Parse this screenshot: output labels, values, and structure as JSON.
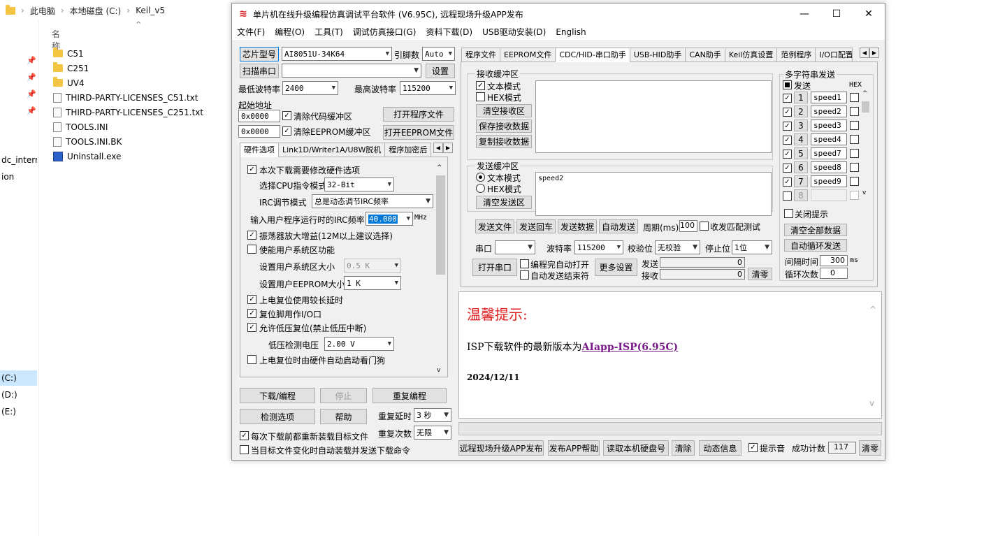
{
  "explorer": {
    "breadcrumb": [
      "此电脑",
      "本地磁盘 (C:)",
      "Keil_v5"
    ],
    "column_name": "名称",
    "files": [
      {
        "name": "C51",
        "icon": "folder-icon"
      },
      {
        "name": "C251",
        "icon": "folder-icon"
      },
      {
        "name": "UV4",
        "icon": "folder-icon"
      },
      {
        "name": "THIRD-PARTY-LICENSES_C51.txt",
        "icon": "text-file-icon"
      },
      {
        "name": "THIRD-PARTY-LICENSES_C251.txt",
        "icon": "text-file-icon"
      },
      {
        "name": "TOOLS.INI",
        "icon": "ini-file-icon"
      },
      {
        "name": "TOOLS.INI.BK",
        "icon": "file-icon"
      },
      {
        "name": "Uninstall.exe",
        "icon": "exe-icon"
      }
    ],
    "nav": [
      "dc_interru",
      "ion",
      "(C:)",
      "(D:)",
      "(E:)"
    ]
  },
  "window": {
    "title": "单片机在线升级编程仿真调试平台软件 (V6.95C), 远程现场升级APP发布",
    "controls": {
      "minimize": "—",
      "maximize": "☐",
      "close": "✕"
    }
  },
  "menu": [
    "文件(F)",
    "编程(O)",
    "工具(T)",
    "调试仿真接口(G)",
    "资料下载(D)",
    "USB驱动安装(D)",
    "English"
  ],
  "left": {
    "chip_button": "芯片型号",
    "chip_value": "AI8051U-34K64",
    "pins_label": "引脚数",
    "pins_value": "Auto",
    "scan_button": "扫描串口",
    "port_value": "",
    "settings_button": "设置",
    "min_baud_label": "最低波特率",
    "min_baud_value": "2400",
    "max_baud_label": "最高波特率",
    "max_baud_value": "115200",
    "start_addr_label": "起始地址",
    "addr1": "0x0000",
    "clear_code_label": "清除代码缓冲区",
    "open_prog_button": "打开程序文件",
    "addr2": "0x0000",
    "clear_eeprom_label": "清除EEPROM缓冲区",
    "open_eeprom_button": "打开EEPROM文件",
    "tabs": [
      "硬件选项",
      "Link1D/Writer1A/U8W脱机",
      "程序加密后"
    ],
    "hw": {
      "opt_modify": "本次下载需要修改硬件选项",
      "cpu_mode_label": "选择CPU指令模式",
      "cpu_mode_value": "32-Bit",
      "irc_mode_label": "IRC调节模式",
      "irc_mode_value": "总是动态调节IRC频率",
      "freq_label": "输入用户程序运行时的IRC频率",
      "freq_value": "40.000",
      "freq_unit": "MHz",
      "osc_gain": "振荡器放大增益(12M以上建议选择)",
      "user_sys": "使能用户系统区功能",
      "sys_size_label": "设置用户系统区大小",
      "sys_size_value": "0.5 K",
      "eeprom_size_label": "设置用户EEPROM大小",
      "eeprom_size_value": "1   K",
      "long_delay": "上电复位使用较长延时",
      "reset_io": "复位脚用作I/O口",
      "lvr": "允许低压复位(禁止低压中断)",
      "lvd_label": "低压检测电压",
      "lvd_value": "2.00 V",
      "wdt": "上电复位时由硬件自动启动看门狗"
    },
    "download_button": "下载/编程",
    "stop_button": "停止",
    "reprogram_button": "重复编程",
    "check_button": "检测选项",
    "help_button": "帮助",
    "repeat_delay_label": "重复延时",
    "repeat_delay_value": "3 秒",
    "repeat_count_label": "重复次数",
    "repeat_count_value": "无限",
    "reload_label": "每次下载前都重新装载目标文件",
    "auto_reload_label": "当目标文件变化时自动装载并发送下载命令"
  },
  "right": {
    "tabs": [
      "程序文件",
      "EEPROM文件",
      "CDC/HID-串口助手",
      "USB-HID助手",
      "CAN助手",
      "Keil仿真设置",
      "范例程序",
      "I/O口配置"
    ],
    "recv": {
      "title": "接收缓冲区",
      "text_mode": "文本模式",
      "hex_mode": "HEX模式",
      "clear": "清空接收区",
      "save": "保存接收数据",
      "copy": "复制接收数据"
    },
    "send": {
      "title": "发送缓冲区",
      "text_mode": "文本模式",
      "hex_mode": "HEX模式",
      "clear": "清空发送区",
      "content": "speed2"
    },
    "send_file": "发送文件",
    "send_enter": "发送回车",
    "send_data": "发送数据",
    "auto_send": "自动发送",
    "period_label": "周期(ms)",
    "period_value": "100",
    "recv_match_label": "收发匹配测试",
    "port_label": "串口",
    "port_value": "",
    "baud_label": "波特率",
    "baud_value": "115200",
    "parity_label": "校验位",
    "parity_value": "无校验",
    "stop_label": "停止位",
    "stop_value": "1位",
    "open_port": "打开串口",
    "auto_open": "编程完自动打开",
    "auto_send_end": "自动发送结束符",
    "more_settings": "更多设置",
    "tx_label": "发送",
    "tx_value": "0",
    "rx_label": "接收",
    "rx_value": "0",
    "clear_counts": "清零",
    "multi": {
      "title": "多字符串发送",
      "send_header": "发送",
      "hex_header": "HEX",
      "rows": [
        {
          "num": "1",
          "text": "speed1"
        },
        {
          "num": "2",
          "text": "speed2"
        },
        {
          "num": "3",
          "text": "speed3"
        },
        {
          "num": "4",
          "text": "speed4"
        },
        {
          "num": "5",
          "text": "speed7"
        },
        {
          "num": "6",
          "text": "speed8"
        },
        {
          "num": "7",
          "text": "speed9"
        },
        {
          "num": "8",
          "text": ""
        }
      ],
      "close_tip": "关闭提示",
      "clear_all": "清空全部数据",
      "auto_loop": "自动循环发送",
      "interval_label": "间隔时间",
      "interval_value": "300",
      "interval_unit": "ms",
      "loop_label": "循环次数",
      "loop_value": "0"
    }
  },
  "notice": {
    "title": "温馨提示:",
    "line_prefix": "ISP下载软件的最新版本为",
    "link": "AIapp-ISP(6.95C)",
    "date": "2024/12/11"
  },
  "bottom": {
    "remote_upgrade": "远程现场升级APP发布",
    "publish_help": "发布APP帮助",
    "read_disk": "读取本机硬盘号",
    "clear": "清除",
    "dynamic_info": "动态信息",
    "beep_label": "提示音",
    "success_label": "成功计数",
    "success_value": "117",
    "clear_count": "清零"
  },
  "colors": {
    "notice_title": "#e02020",
    "link": "#7a1a8a",
    "selection": "#0078d7"
  }
}
